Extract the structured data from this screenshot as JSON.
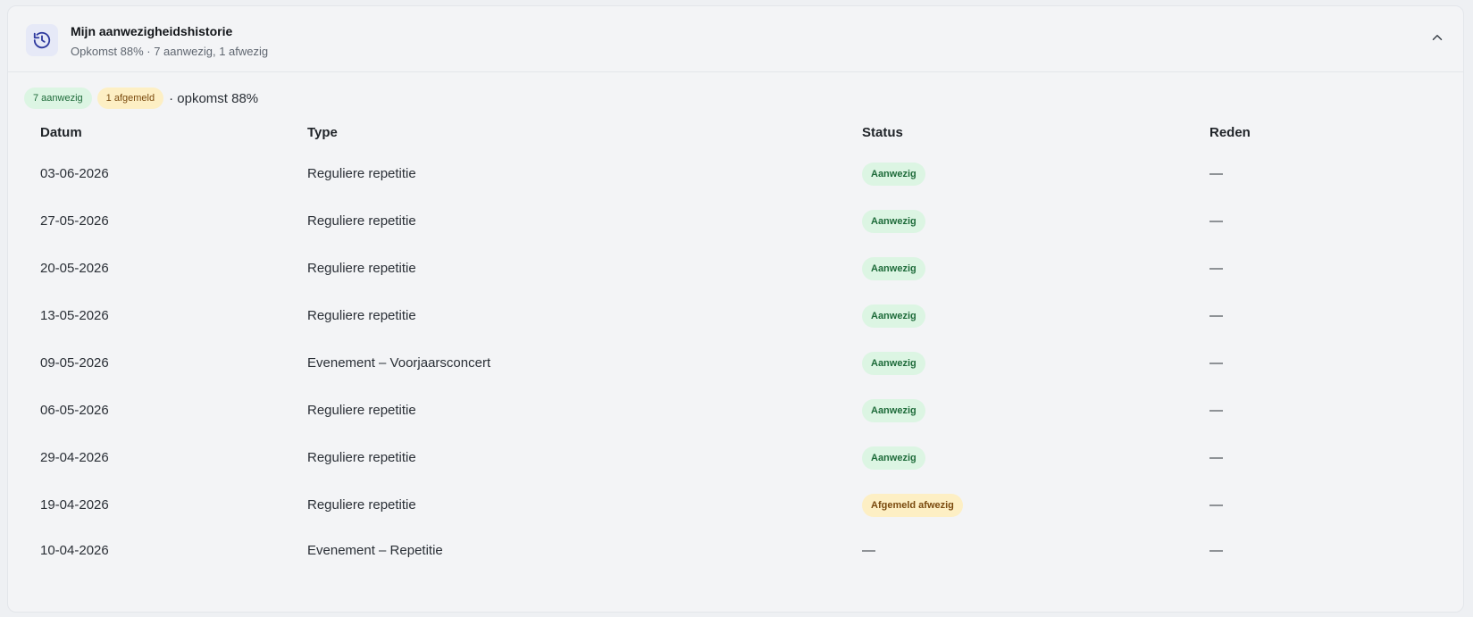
{
  "header": {
    "title": "Mijn aanwezigheidshistorie",
    "subtitle": "Opkomst 88% · 7 aanwezig, 1 afwezig",
    "icon": "history-icon",
    "collapse_icon": "chevron-up-icon"
  },
  "summary": {
    "present_badge": "7 aanwezig",
    "excused_badge": "1 afgemeld",
    "attendance_text": "· opkomst 88%"
  },
  "table": {
    "headers": {
      "date": "Datum",
      "type": "Type",
      "status": "Status",
      "reason": "Reden"
    },
    "rows": [
      {
        "date": "03-06-2026",
        "type": "Reguliere repetitie",
        "status": "Aanwezig",
        "status_kind": "present",
        "reason": "—"
      },
      {
        "date": "27-05-2026",
        "type": "Reguliere repetitie",
        "status": "Aanwezig",
        "status_kind": "present",
        "reason": "—"
      },
      {
        "date": "20-05-2026",
        "type": "Reguliere repetitie",
        "status": "Aanwezig",
        "status_kind": "present",
        "reason": "—"
      },
      {
        "date": "13-05-2026",
        "type": "Reguliere repetitie",
        "status": "Aanwezig",
        "status_kind": "present",
        "reason": "—"
      },
      {
        "date": "09-05-2026",
        "type": "Evenement – Voorjaarsconcert",
        "status": "Aanwezig",
        "status_kind": "present",
        "reason": "—"
      },
      {
        "date": "06-05-2026",
        "type": "Reguliere repetitie",
        "status": "Aanwezig",
        "status_kind": "present",
        "reason": "—"
      },
      {
        "date": "29-04-2026",
        "type": "Reguliere repetitie",
        "status": "Aanwezig",
        "status_kind": "present",
        "reason": "—"
      },
      {
        "date": "19-04-2026",
        "type": "Reguliere repetitie",
        "status": "Afgemeld afwezig",
        "status_kind": "excused",
        "reason": "—"
      },
      {
        "date": "10-04-2026",
        "type": "Evenement – Repetitie",
        "status": "—",
        "status_kind": "none",
        "reason": "—"
      }
    ]
  },
  "colors": {
    "present_bg": "#dcf5e3",
    "present_text": "#1e6b3a",
    "excused_bg": "#fdefc4",
    "excused_text": "#7a4a0e",
    "icon_accent": "#2f3a9e"
  }
}
